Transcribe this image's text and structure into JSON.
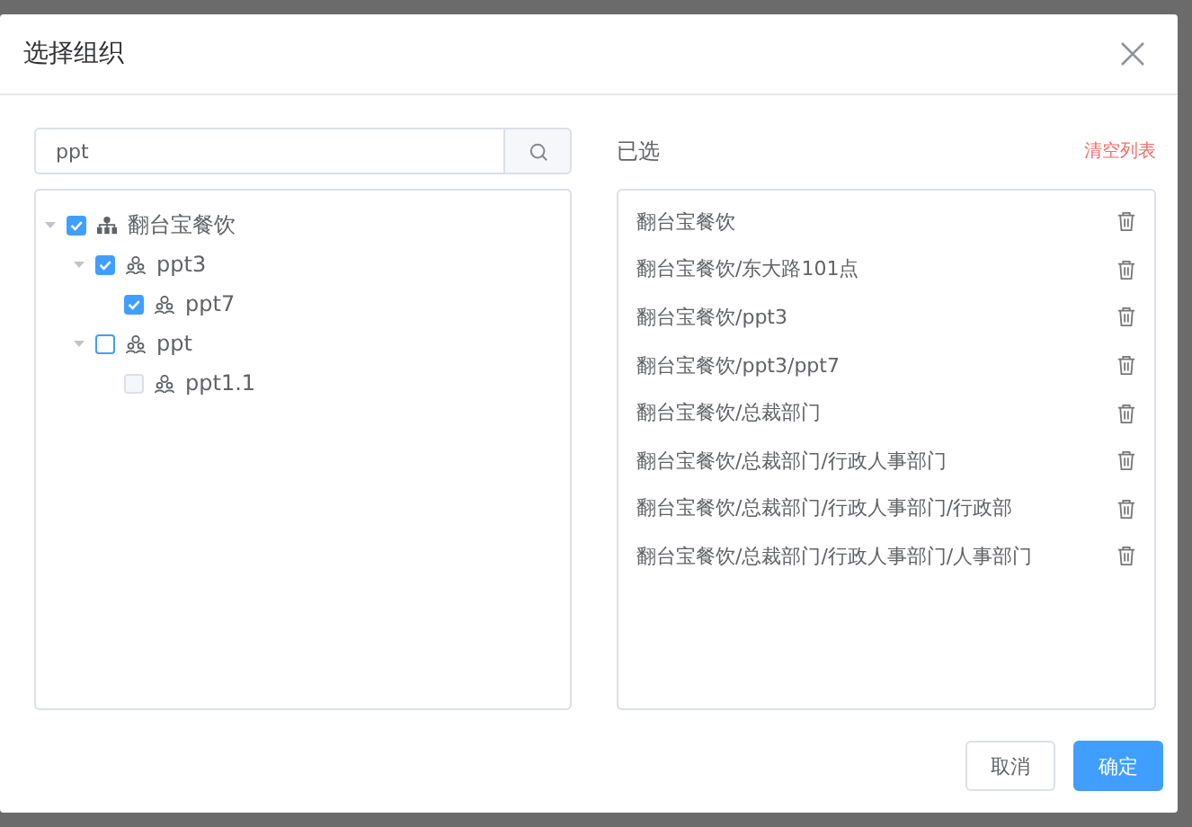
{
  "dialog": {
    "title": "选择组织"
  },
  "search": {
    "value": "ppt"
  },
  "tree": [
    {
      "label": "翻台宝餐饮",
      "checked": true,
      "disabled": false,
      "expanded": true,
      "children": [
        {
          "label": "ppt3",
          "checked": true,
          "disabled": false,
          "expanded": true,
          "children": [
            {
              "label": "ppt7",
              "checked": true,
              "disabled": false
            }
          ]
        },
        {
          "label": "ppt",
          "checked": false,
          "disabled": false,
          "expanded": true,
          "children": [
            {
              "label": "ppt1.1",
              "checked": false,
              "disabled": true
            }
          ]
        }
      ]
    }
  ],
  "selected_panel": {
    "title": "已选",
    "clear_link": "清空列表",
    "items": [
      "翻台宝餐饮",
      "翻台宝餐饮/东大路101点",
      "翻台宝餐饮/ppt3",
      "翻台宝餐饮/ppt3/ppt7",
      "翻台宝餐饮/总裁部门",
      "翻台宝餐饮/总裁部门/行政人事部门",
      "翻台宝餐饮/总裁部门/行政人事部门/行政部",
      "翻台宝餐饮/总裁部门/行政人事部门/人事部门"
    ]
  },
  "buttons": [
    {
      "label": "取消",
      "kind": "secondary"
    },
    {
      "label": "确定",
      "kind": "primary"
    }
  ]
}
